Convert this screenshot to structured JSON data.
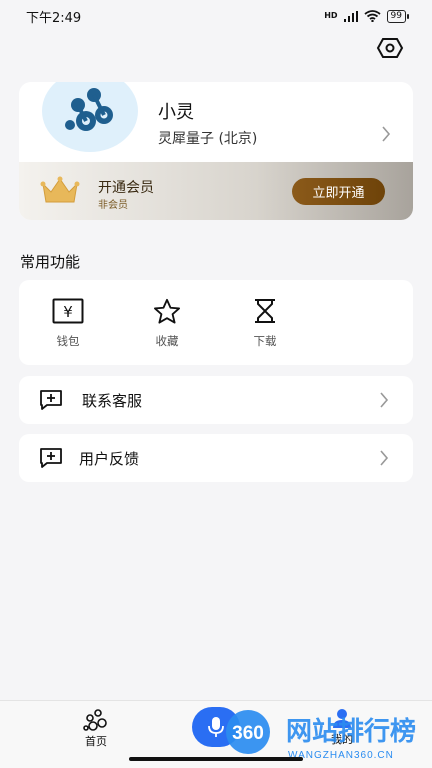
{
  "status_bar": {
    "time": "下午2:49",
    "network": "HD",
    "battery": "99"
  },
  "profile": {
    "name": "小灵",
    "org": "灵犀量子 (北京)"
  },
  "vip": {
    "title": "开通会员",
    "status": "非会员",
    "button": "立即开通"
  },
  "section_title": "常用功能",
  "functions": [
    {
      "label": "钱包",
      "icon": "wallet-icon"
    },
    {
      "label": "收藏",
      "icon": "star-icon"
    },
    {
      "label": "下载",
      "icon": "download-icon"
    }
  ],
  "list": [
    {
      "label": "联系客服",
      "icon": "message-plus-icon"
    },
    {
      "label": "用户反馈",
      "icon": "message-plus-icon"
    }
  ],
  "tabbar": {
    "home": "首页",
    "mine": "我的"
  },
  "watermark": {
    "brand": "360",
    "title": "网站排行榜",
    "url": "WANGZHAN360.CN"
  },
  "colors": {
    "accent_blue": "#2a6ef3",
    "vip_brown": "#7a4b10",
    "logo_blue": "#1f5f8f"
  }
}
